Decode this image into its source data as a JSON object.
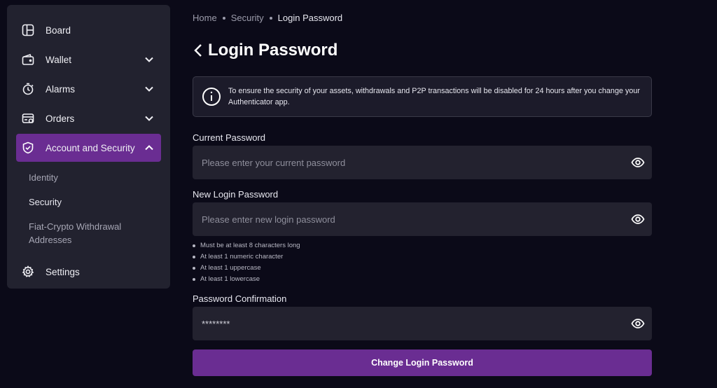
{
  "sidebar": {
    "items": [
      {
        "label": "Board",
        "icon": "layout-icon"
      },
      {
        "label": "Wallet",
        "icon": "wallet-icon"
      },
      {
        "label": "Alarms",
        "icon": "alarm-clock-icon"
      },
      {
        "label": "Orders",
        "icon": "orders-icon"
      },
      {
        "label": "Account and Security",
        "icon": "shield-icon",
        "active": true
      },
      {
        "label": "Settings",
        "icon": "gear-icon"
      }
    ],
    "sub_items": [
      {
        "label": "Identity"
      },
      {
        "label": "Security",
        "current": true
      },
      {
        "label": "Fiat-Crypto Withdrawal Addresses"
      }
    ]
  },
  "breadcrumb": [
    "Home",
    "Security",
    "Login Password"
  ],
  "page_title": "Login Password",
  "notice": "To ensure the security of your assets, withdrawals and P2P transactions will be disabled for 24 hours after you change your Authenticator app.",
  "form": {
    "current": {
      "label": "Current Password",
      "placeholder": "Please enter your current password",
      "value": ""
    },
    "new": {
      "label": "New Login Password",
      "placeholder": "Please enter new login password",
      "value": ""
    },
    "rules": [
      "Must be at least 8 characters long",
      "At least 1 numeric character",
      "At least 1 uppercase",
      "At least 1 lowercase"
    ],
    "confirm": {
      "label": "Password Confirmation",
      "placeholder": "",
      "value": "********"
    },
    "submit_label": "Change Login Password"
  },
  "colors": {
    "background": "#0b0a18",
    "panel": "#22222f",
    "accent": "#6a2d92"
  }
}
